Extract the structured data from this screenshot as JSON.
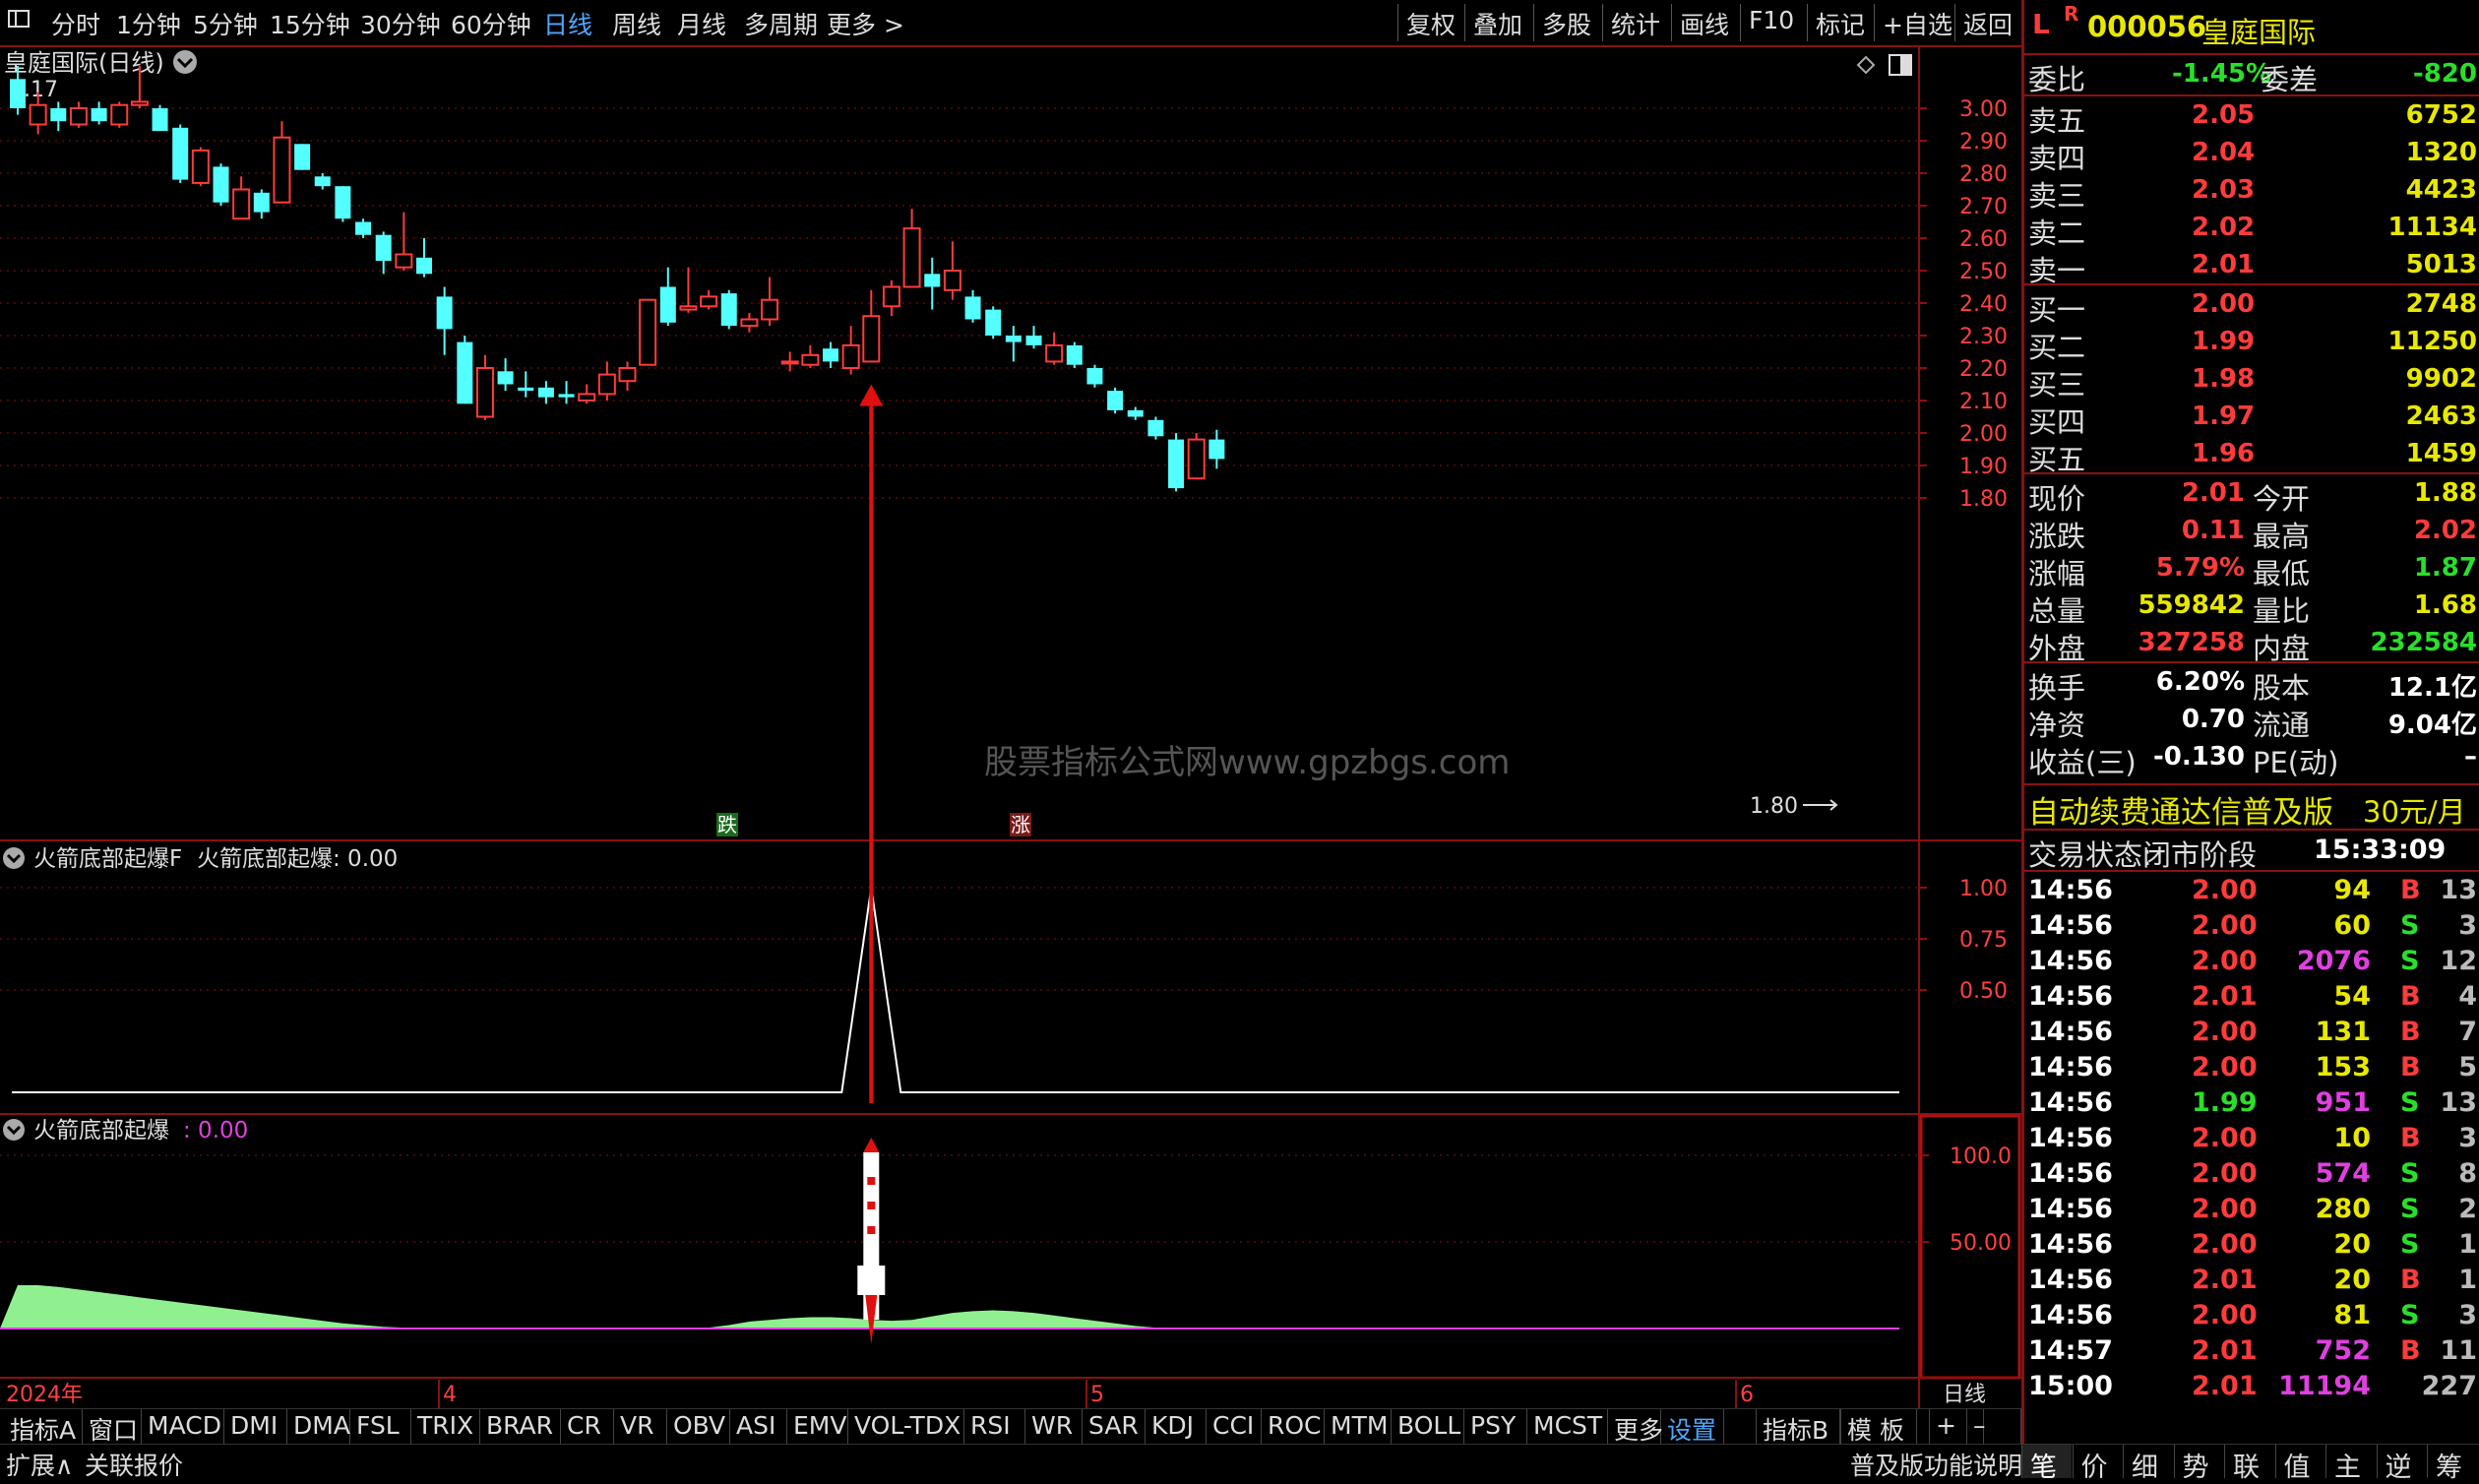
{
  "toolbar": {
    "left_icon": "layout-icon",
    "periods": [
      "分时",
      "1分钟",
      "5分钟",
      "15分钟",
      "30分钟",
      "60分钟",
      "日线",
      "周线",
      "月线",
      "多周期",
      "更多 >"
    ],
    "active_period": "日线",
    "right_buttons": [
      "复权",
      "叠加",
      "多股",
      "统计",
      "画线",
      "F10",
      "标记",
      "+自选",
      "返回"
    ]
  },
  "chart": {
    "title": "皇庭国际(日线)",
    "high_marker": "3.17",
    "low_marker": "1.80",
    "watermark": "股票指标公式网www.gpzbgs.com",
    "badge_fall": "跌",
    "badge_rise": "涨",
    "indicator1_title": "火箭底部起爆F",
    "indicator1_value": "火箭底部起爆: 0.00",
    "indicator2_title": "火箭底部起爆",
    "indicator2_value": ": 0.00",
    "date_labels": [
      "2024年",
      "4",
      "5",
      "6"
    ],
    "period_label": "日线",
    "price_ticks": [
      "3.00",
      "2.90",
      "2.80",
      "2.70",
      "2.60",
      "2.50",
      "2.40",
      "2.30",
      "2.20",
      "2.10",
      "2.00",
      "1.90",
      "1.80"
    ],
    "ind1_ticks": [
      "1.00",
      "0.75",
      "0.50"
    ],
    "ind2_ticks": [
      "100.0",
      "50.00"
    ],
    "colors": {
      "up": "#ff3b3b",
      "down": "#54ffff",
      "grid": "#8b1010",
      "area": "#90f090"
    }
  },
  "chart_data": {
    "type": "candlestick",
    "ylim": [
      1.77,
      3.17
    ],
    "candles": [
      {
        "o": 3.09,
        "c": 3.0,
        "h": 3.13,
        "l": 2.98
      },
      {
        "o": 2.95,
        "c": 3.01,
        "h": 3.05,
        "l": 2.92
      },
      {
        "o": 3.0,
        "c": 2.96,
        "h": 3.02,
        "l": 2.93
      },
      {
        "o": 2.95,
        "c": 3.0,
        "h": 3.02,
        "l": 2.94
      },
      {
        "o": 3.0,
        "c": 2.96,
        "h": 3.02,
        "l": 2.95
      },
      {
        "o": 2.95,
        "c": 3.01,
        "h": 3.02,
        "l": 2.94
      },
      {
        "o": 3.01,
        "c": 3.02,
        "h": 3.13,
        "l": 3.0
      },
      {
        "o": 3.0,
        "c": 2.93,
        "h": 3.01,
        "l": 2.93
      },
      {
        "o": 2.94,
        "c": 2.78,
        "h": 2.95,
        "l": 2.77
      },
      {
        "o": 2.77,
        "c": 2.87,
        "h": 2.88,
        "l": 2.76
      },
      {
        "o": 2.82,
        "c": 2.71,
        "h": 2.83,
        "l": 2.7
      },
      {
        "o": 2.66,
        "c": 2.75,
        "h": 2.79,
        "l": 2.66
      },
      {
        "o": 2.74,
        "c": 2.68,
        "h": 2.75,
        "l": 2.66
      },
      {
        "o": 2.71,
        "c": 2.91,
        "h": 2.96,
        "l": 2.71
      },
      {
        "o": 2.89,
        "c": 2.81,
        "h": 2.89,
        "l": 2.81
      },
      {
        "o": 2.79,
        "c": 2.76,
        "h": 2.8,
        "l": 2.75
      },
      {
        "o": 2.76,
        "c": 2.66,
        "h": 2.76,
        "l": 2.65
      },
      {
        "o": 2.65,
        "c": 2.61,
        "h": 2.66,
        "l": 2.6
      },
      {
        "o": 2.61,
        "c": 2.53,
        "h": 2.62,
        "l": 2.49
      },
      {
        "o": 2.51,
        "c": 2.55,
        "h": 2.68,
        "l": 2.5
      },
      {
        "o": 2.54,
        "c": 2.49,
        "h": 2.6,
        "l": 2.48
      },
      {
        "o": 2.42,
        "c": 2.32,
        "h": 2.45,
        "l": 2.24
      },
      {
        "o": 2.28,
        "c": 2.09,
        "h": 2.3,
        "l": 2.09
      },
      {
        "o": 2.05,
        "c": 2.2,
        "h": 2.24,
        "l": 2.04
      },
      {
        "o": 2.19,
        "c": 2.15,
        "h": 2.23,
        "l": 2.13
      },
      {
        "o": 2.14,
        "c": 2.13,
        "h": 2.19,
        "l": 2.11
      },
      {
        "o": 2.14,
        "c": 2.11,
        "h": 2.16,
        "l": 2.09
      },
      {
        "o": 2.12,
        "c": 2.11,
        "h": 2.16,
        "l": 2.09
      },
      {
        "o": 2.1,
        "c": 2.12,
        "h": 2.15,
        "l": 2.09
      },
      {
        "o": 2.12,
        "c": 2.18,
        "h": 2.22,
        "l": 2.1
      },
      {
        "o": 2.16,
        "c": 2.2,
        "h": 2.22,
        "l": 2.13
      },
      {
        "o": 2.21,
        "c": 2.41,
        "h": 2.41,
        "l": 2.21
      },
      {
        "o": 2.45,
        "c": 2.34,
        "h": 2.51,
        "l": 2.33
      },
      {
        "o": 2.38,
        "c": 2.39,
        "h": 2.51,
        "l": 2.37
      },
      {
        "o": 2.39,
        "c": 2.42,
        "h": 2.44,
        "l": 2.38
      },
      {
        "o": 2.43,
        "c": 2.33,
        "h": 2.44,
        "l": 2.32
      },
      {
        "o": 2.33,
        "c": 2.35,
        "h": 2.37,
        "l": 2.31
      },
      {
        "o": 2.35,
        "c": 2.41,
        "h": 2.48,
        "l": 2.33
      },
      {
        "o": 2.22,
        "c": 2.22,
        "h": 2.25,
        "l": 2.19
      },
      {
        "o": 2.21,
        "c": 2.24,
        "h": 2.27,
        "l": 2.2
      },
      {
        "o": 2.26,
        "c": 2.22,
        "h": 2.28,
        "l": 2.2
      },
      {
        "o": 2.2,
        "c": 2.27,
        "h": 2.33,
        "l": 2.18
      },
      {
        "o": 2.22,
        "c": 2.36,
        "h": 2.44,
        "l": 2.22
      },
      {
        "o": 2.39,
        "c": 2.45,
        "h": 2.47,
        "l": 2.36
      },
      {
        "o": 2.45,
        "c": 2.63,
        "h": 2.69,
        "l": 2.45
      },
      {
        "o": 2.49,
        "c": 2.45,
        "h": 2.54,
        "l": 2.38
      },
      {
        "o": 2.44,
        "c": 2.5,
        "h": 2.59,
        "l": 2.41
      },
      {
        "o": 2.42,
        "c": 2.35,
        "h": 2.44,
        "l": 2.34
      },
      {
        "o": 2.38,
        "c": 2.3,
        "h": 2.39,
        "l": 2.29
      },
      {
        "o": 2.3,
        "c": 2.28,
        "h": 2.33,
        "l": 2.22
      },
      {
        "o": 2.3,
        "c": 2.27,
        "h": 2.33,
        "l": 2.26
      },
      {
        "o": 2.22,
        "c": 2.27,
        "h": 2.31,
        "l": 2.21
      },
      {
        "o": 2.27,
        "c": 2.21,
        "h": 2.28,
        "l": 2.2
      },
      {
        "o": 2.2,
        "c": 2.15,
        "h": 2.21,
        "l": 2.14
      },
      {
        "o": 2.13,
        "c": 2.07,
        "h": 2.14,
        "l": 2.06
      },
      {
        "o": 2.07,
        "c": 2.05,
        "h": 2.08,
        "l": 2.04
      },
      {
        "o": 2.04,
        "c": 1.99,
        "h": 2.05,
        "l": 1.98
      },
      {
        "o": 1.98,
        "c": 1.83,
        "h": 2.0,
        "l": 1.82
      },
      {
        "o": 1.86,
        "c": 1.98,
        "h": 2.0,
        "l": 1.86
      },
      {
        "o": 1.98,
        "c": 1.92,
        "h": 2.01,
        "l": 1.89
      }
    ],
    "signal_index": 42,
    "indicator1": {
      "ylim": [
        0,
        1.2
      ],
      "spike_index": 42,
      "spike_value": 1.0
    },
    "indicator2": {
      "ylim": [
        0,
        110
      ],
      "area": [
        50,
        50,
        48,
        45,
        42,
        39,
        36,
        33,
        30,
        27,
        24,
        21,
        18,
        15,
        12,
        9,
        6,
        4,
        2,
        1,
        0,
        0,
        0,
        0,
        0,
        0,
        0,
        0,
        0,
        0,
        0,
        0,
        0,
        0,
        1,
        4,
        8,
        10,
        12,
        13,
        13,
        12,
        10,
        9,
        10,
        14,
        18,
        20,
        21,
        20,
        18,
        15,
        12,
        9,
        6,
        3,
        1,
        0,
        0,
        0
      ]
    },
    "price_ticks": [
      3.0,
      2.9,
      2.8,
      2.7,
      2.6,
      2.5,
      2.4,
      2.3,
      2.2,
      2.1,
      2.0,
      1.9,
      1.8
    ]
  },
  "quote": {
    "badge_l": "L",
    "badge_r": "R",
    "code": "000056",
    "name": "皇庭国际",
    "weibi_label": "委比",
    "weibi_value": "-1.45%",
    "weicha_label": "委差",
    "weicha_value": "-820",
    "sells": [
      {
        "label": "卖五",
        "price": "2.05",
        "vol": "6752"
      },
      {
        "label": "卖四",
        "price": "2.04",
        "vol": "1320"
      },
      {
        "label": "卖三",
        "price": "2.03",
        "vol": "4423"
      },
      {
        "label": "卖二",
        "price": "2.02",
        "vol": "11134"
      },
      {
        "label": "卖一",
        "price": "2.01",
        "vol": "5013"
      }
    ],
    "buys": [
      {
        "label": "买一",
        "price": "2.00",
        "vol": "2748"
      },
      {
        "label": "买二",
        "price": "1.99",
        "vol": "11250"
      },
      {
        "label": "买三",
        "price": "1.98",
        "vol": "9902"
      },
      {
        "label": "买四",
        "price": "1.97",
        "vol": "2463"
      },
      {
        "label": "买五",
        "price": "1.96",
        "vol": "1459"
      }
    ],
    "stats": [
      {
        "l1": "现价",
        "v1": "2.01",
        "l2": "今开",
        "v2": "1.88"
      },
      {
        "l1": "涨跌",
        "v1": "0.11",
        "l2": "最高",
        "v2": "2.02"
      },
      {
        "l1": "涨幅",
        "v1": "5.79%",
        "l2": "最低",
        "v2": "1.87"
      },
      {
        "l1": "总量",
        "v1": "559842",
        "l2": "量比",
        "v2": "1.68"
      },
      {
        "l1": "外盘",
        "v1": "327258",
        "l2": "内盘",
        "v2": "232584"
      }
    ],
    "stats2": [
      {
        "l1": "换手",
        "v1": "6.20%",
        "l2": "股本",
        "v2": "12.1亿"
      },
      {
        "l1": "净资",
        "v1": "0.70",
        "l2": "流通",
        "v2": "9.04亿"
      },
      {
        "l1": "收益(三)",
        "v1": "-0.130",
        "l2": "PE(动)",
        "v2": "–"
      }
    ],
    "promo_text": "自动续费通达信普及版",
    "promo_price": "30元/月",
    "status_label": "交易状态:",
    "status_value": "闭市阶段",
    "status_time": "15:33:09",
    "ticks": [
      {
        "t": "14:56",
        "p": "2.00",
        "v": "94",
        "s": "B",
        "n": "13"
      },
      {
        "t": "14:56",
        "p": "2.00",
        "v": "60",
        "s": "S",
        "n": "3"
      },
      {
        "t": "14:56",
        "p": "2.00",
        "v": "2076",
        "s": "S",
        "n": "12"
      },
      {
        "t": "14:56",
        "p": "2.01",
        "v": "54",
        "s": "B",
        "n": "4"
      },
      {
        "t": "14:56",
        "p": "2.00",
        "v": "131",
        "s": "B",
        "n": "7"
      },
      {
        "t": "14:56",
        "p": "2.00",
        "v": "153",
        "s": "B",
        "n": "5"
      },
      {
        "t": "14:56",
        "p": "1.99",
        "v": "951",
        "s": "S",
        "n": "13"
      },
      {
        "t": "14:56",
        "p": "2.00",
        "v": "10",
        "s": "B",
        "n": "3"
      },
      {
        "t": "14:56",
        "p": "2.00",
        "v": "574",
        "s": "S",
        "n": "8"
      },
      {
        "t": "14:56",
        "p": "2.00",
        "v": "280",
        "s": "S",
        "n": "2"
      },
      {
        "t": "14:56",
        "p": "2.00",
        "v": "20",
        "s": "S",
        "n": "1"
      },
      {
        "t": "14:56",
        "p": "2.01",
        "v": "20",
        "s": "B",
        "n": "1"
      },
      {
        "t": "14:56",
        "p": "2.00",
        "v": "81",
        "s": "S",
        "n": "3"
      },
      {
        "t": "14:57",
        "p": "2.01",
        "v": "752",
        "s": "B",
        "n": "11"
      },
      {
        "t": "15:00",
        "p": "2.01",
        "v": "11194",
        "s": "",
        "n": "227"
      }
    ]
  },
  "tabs": [
    "指标A",
    "窗口",
    "MACD",
    "DMI",
    "DMA",
    "FSL",
    "TRIX",
    "BRAR",
    "CR",
    "VR",
    "OBV",
    "ASI",
    "EMV",
    "VOL-TDX",
    "RSI",
    "WR",
    "SAR",
    "KDJ",
    "CCI",
    "ROC",
    "MTM",
    "BOLL",
    "PSY",
    "MCST",
    "更多",
    "设置"
  ],
  "tabs_right": [
    "指标B",
    "模 板",
    "+",
    "–"
  ],
  "statusbar": {
    "left": [
      "扩展∧",
      "关联报价"
    ],
    "right_text": "普及版功能说明",
    "right_tabs": [
      "笔",
      "价",
      "细",
      "势",
      "联",
      "值",
      "主",
      "逆",
      "筹"
    ]
  }
}
